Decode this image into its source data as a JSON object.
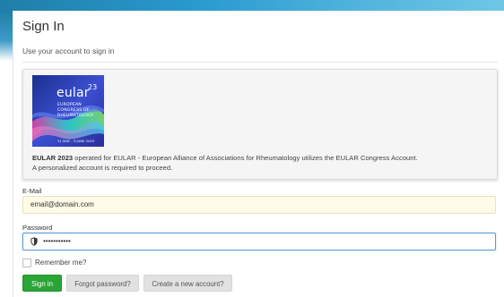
{
  "header": {
    "title": "Sign In",
    "subtitle": "Use your account to sign in"
  },
  "info": {
    "logo": {
      "brand": "eular",
      "superscript": "23",
      "lines": [
        "EUROPEAN",
        "CONGRESS OF",
        "RHEUMATOLOGY"
      ],
      "dates": "31 MAY - 3 JUNE 2023"
    },
    "event_name": "EULAR 2023",
    "line1_rest": " operated for EULAR - European Alliance of Associations for Rheumatology utilizes the EULAR Congress Account.",
    "line2": "A personalized account is required to proceed."
  },
  "form": {
    "email_label": "E-Mail",
    "email_value": "email@domain.com",
    "password_label": "Password",
    "password_value": "•••••••••••",
    "remember_label": "Remember me?",
    "remember_checked": false
  },
  "buttons": {
    "signin": "Sign in",
    "forgot": "Forgot password?",
    "create": "Create a new account?"
  },
  "colors": {
    "primary_button": "#2aa536",
    "secondary_button": "#e1e1e1",
    "autofill_bg": "#fefbe7",
    "focus_border": "#5b9bd5"
  },
  "icons": {
    "password_prefix": "shield-icon"
  }
}
